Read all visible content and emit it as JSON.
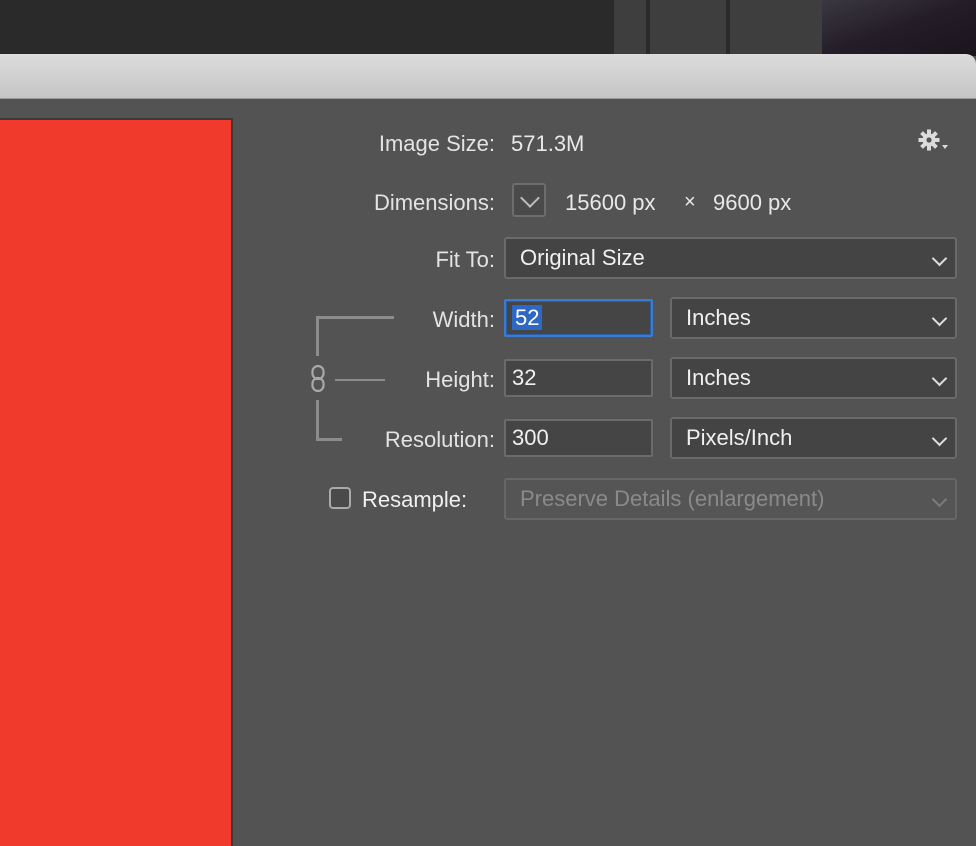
{
  "dialog": {
    "image_size_label": "Image Size:",
    "image_size_value": "571.3M",
    "dimensions_label": "Dimensions:",
    "dimensions_width": "15600 px",
    "dimensions_times": "×",
    "dimensions_height": "9600 px",
    "fit_to_label": "Fit To:",
    "fit_to_value": "Original Size",
    "width_label": "Width:",
    "width_value": "52",
    "width_unit": "Inches",
    "height_label": "Height:",
    "height_value": "32",
    "height_unit": "Inches",
    "resolution_label": "Resolution:",
    "resolution_value": "300",
    "resolution_unit": "Pixels/Inch",
    "resample_label": "Resample:",
    "resample_value": "Preserve Details (enlargement)",
    "resample_checked": false
  },
  "colors": {
    "panel_bg": "#535353",
    "preview_fill": "#ef3a2c",
    "focus_accent": "#3b7bd0"
  },
  "icons": {
    "settings": "gear-icon",
    "link": "chain-link-icon",
    "dimensions_toggle": "chevron-down-icon"
  }
}
